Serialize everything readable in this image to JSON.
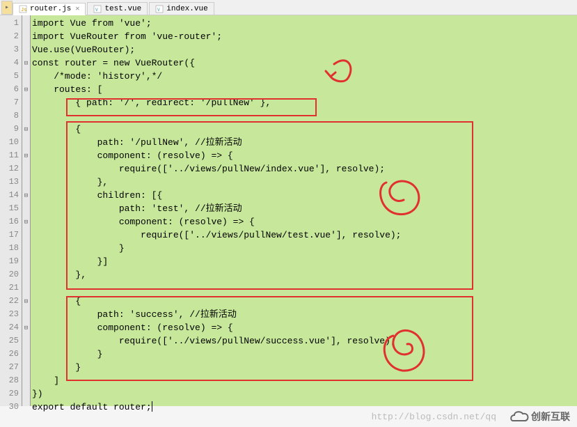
{
  "tabs": [
    {
      "label": "router.js",
      "active": true,
      "icon": "js"
    },
    {
      "label": "test.vue",
      "active": false,
      "icon": "vue"
    },
    {
      "label": "index.vue",
      "active": false,
      "icon": "vue"
    }
  ],
  "code_lines": [
    "import Vue from 'vue';",
    "import VueRouter from 'vue-router';",
    "Vue.use(VueRouter);",
    "const router = new VueRouter({",
    "    /*mode: 'history',*/",
    "    routes: [",
    "        { path: '/', redirect: '/pullNew' },",
    "",
    "        {",
    "            path: '/pullNew', //拉新活动",
    "            component: (resolve) => {",
    "                require(['../views/pullNew/index.vue'], resolve);",
    "            },",
    "            children: [{",
    "                path: 'test', //拉新活动",
    "                component: (resolve) => {",
    "                    require(['../views/pullNew/test.vue'], resolve);",
    "                }",
    "            }]",
    "        },",
    "",
    "        {",
    "            path: 'success', //拉新活动",
    "            component: (resolve) => {",
    "                require(['../views/pullNew/success.vue'], resolve);",
    "            }",
    "        }",
    "    ]",
    "})",
    "export default router;"
  ],
  "line_count": 30,
  "fold_lines": [
    4,
    6,
    9,
    11,
    14,
    16,
    22,
    24
  ],
  "watermark": "http://blog.csdn.net/qq",
  "logo_text": "创新互联"
}
